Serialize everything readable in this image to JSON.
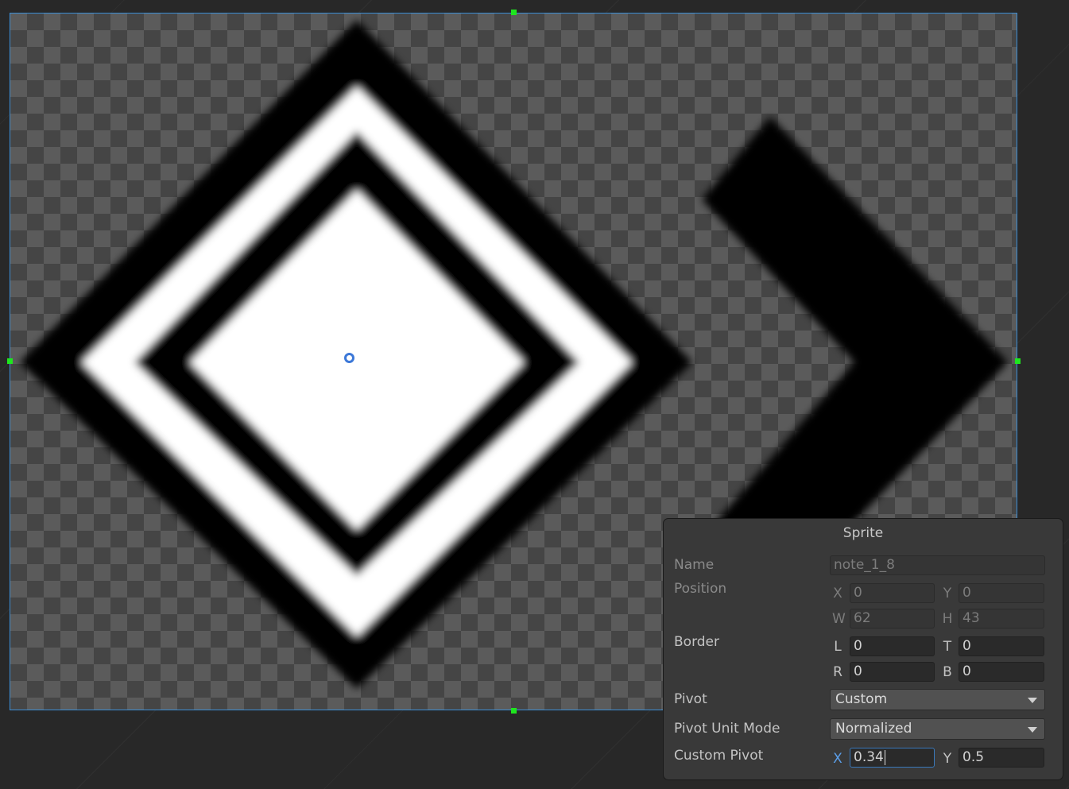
{
  "panel": {
    "title": "Sprite",
    "name_label": "Name",
    "name_value": "note_1_8",
    "position_label": "Position",
    "position": {
      "x_label": "X",
      "x_value": "0",
      "y_label": "Y",
      "y_value": "0",
      "w_label": "W",
      "w_value": "62",
      "h_label": "H",
      "h_value": "43"
    },
    "border_label": "Border",
    "border": {
      "l_label": "L",
      "l_value": "0",
      "t_label": "T",
      "t_value": "0",
      "r_label": "R",
      "r_value": "0",
      "b_label": "B",
      "b_value": "0"
    },
    "pivot_label": "Pivot",
    "pivot_value": "Custom",
    "pivot_unit_mode_label": "Pivot Unit Mode",
    "pivot_unit_mode_value": "Normalized",
    "custom_pivot_label": "Custom Pivot",
    "custom_pivot": {
      "x_label": "X",
      "x_value": "0.34",
      "y_label": "Y",
      "y_value": "0.5"
    }
  },
  "colors": {
    "handle": "#1ee61e",
    "selection_border": "#3b8ed6",
    "pivot": "#3c78d8"
  },
  "icons": {
    "pivot": "pivot-circle-icon",
    "dropdown": "chevron-down-icon"
  }
}
